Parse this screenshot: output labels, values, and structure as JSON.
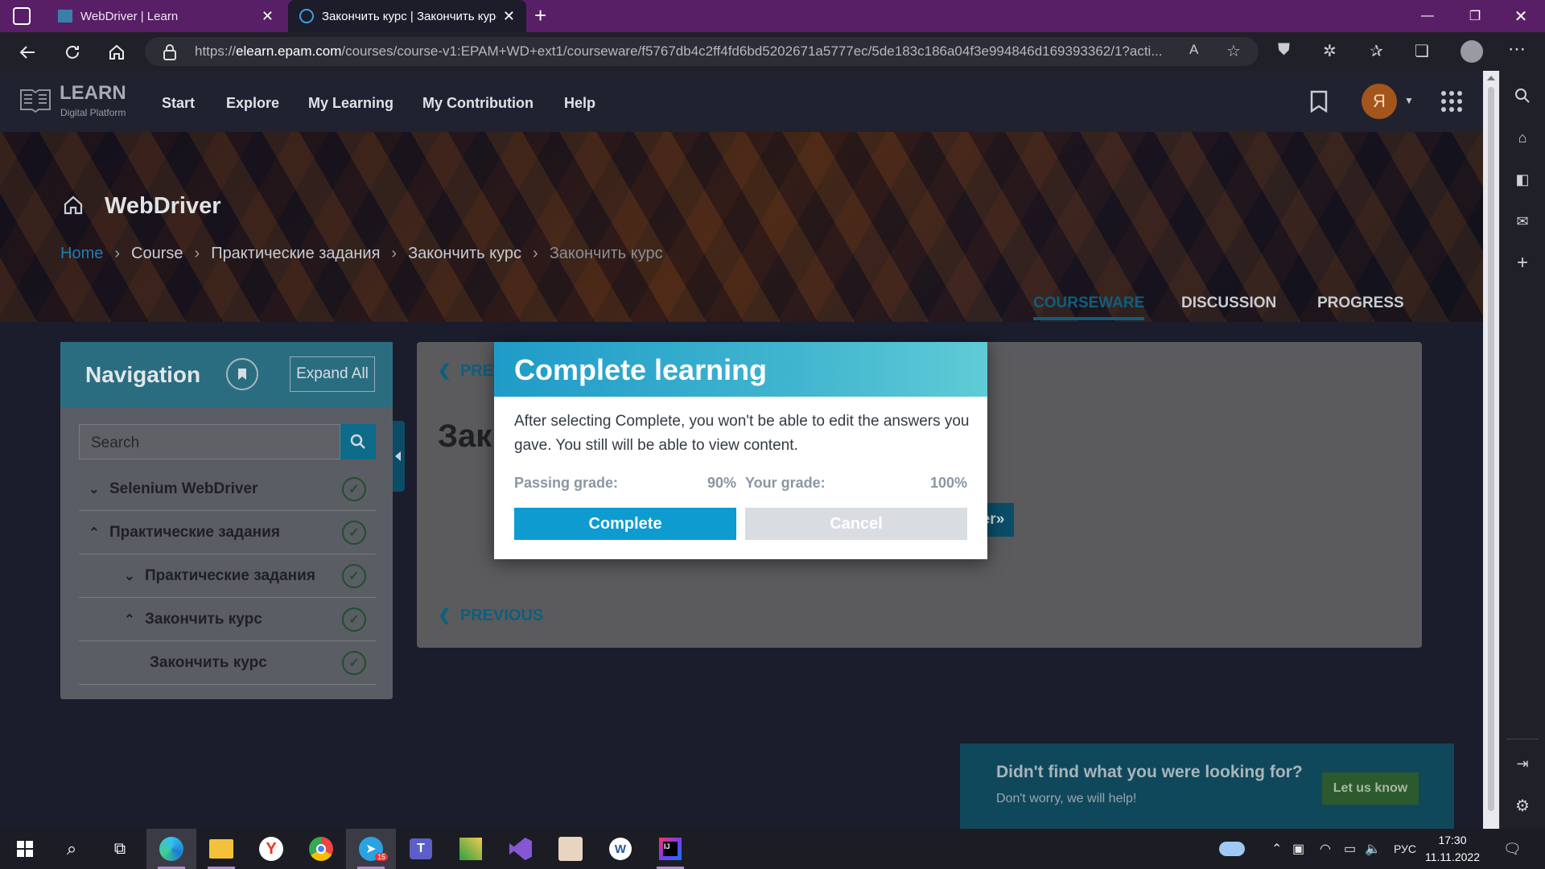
{
  "browser": {
    "tabs": [
      {
        "title": "WebDriver | Learn",
        "active": false
      },
      {
        "title": "Закончить курс | Закончить курс",
        "active": true
      }
    ],
    "url_prefix": "https://",
    "url_domain": "elearn.epam.com",
    "url_rest": "/courses/course-v1:EPAM+WD+ext1/courseware/f5767db4c2ff4fd6bd5202671a5777ec/5de183c186a04f3e994846d169393362/1?acti..."
  },
  "site": {
    "logo_title": "LEARN",
    "logo_subtitle": "Digital Platform",
    "nav": [
      "Start",
      "Explore",
      "My Learning",
      "My Contribution",
      "Help"
    ],
    "avatar_letter": "Я"
  },
  "course": {
    "title": "WebDriver",
    "breadcrumb": [
      "Home",
      "Course",
      "Практические задания",
      "Закончить курс",
      "Закончить курс"
    ],
    "tabs": [
      "COURSEWARE",
      "DISCUSSION",
      "PROGRESS"
    ]
  },
  "navigation": {
    "title": "Navigation",
    "expand_label": "Expand All",
    "search_placeholder": "Search",
    "items": [
      {
        "label": "Selenium WebDriver",
        "chevron": "⌄"
      },
      {
        "label": "Практические задания",
        "chevron": "⌃"
      },
      {
        "label": "Практические задания",
        "chevron": "⌄"
      },
      {
        "label": "Закончить курс",
        "chevron": "⌃"
      },
      {
        "label": "Закончить курс",
        "chevron": ""
      }
    ]
  },
  "content": {
    "prev_top": "PREV",
    "title": "Зак",
    "next_label": "er»",
    "prev_bottom": "PREVIOUS"
  },
  "help": {
    "question": "Didn't find what you were looking for?",
    "sub": "Don't worry, we will help!",
    "button": "Let us know"
  },
  "modal": {
    "title": "Complete learning",
    "body": "After selecting Complete, you won't be able to edit the answers you gave. You still will be able to view content.",
    "passing_label": "Passing grade:",
    "passing_value": "90%",
    "your_label": "Your grade:",
    "your_value": "100%",
    "complete_label": "Complete",
    "cancel_label": "Cancel"
  },
  "taskbar": {
    "lang": "РУС",
    "time": "17:30",
    "date": "11.11.2022",
    "telegram_badge": "15"
  },
  "colors": {
    "titlebar": "#591f66",
    "accent": "#0e9bd0",
    "modal_header": "#40b5cf"
  }
}
